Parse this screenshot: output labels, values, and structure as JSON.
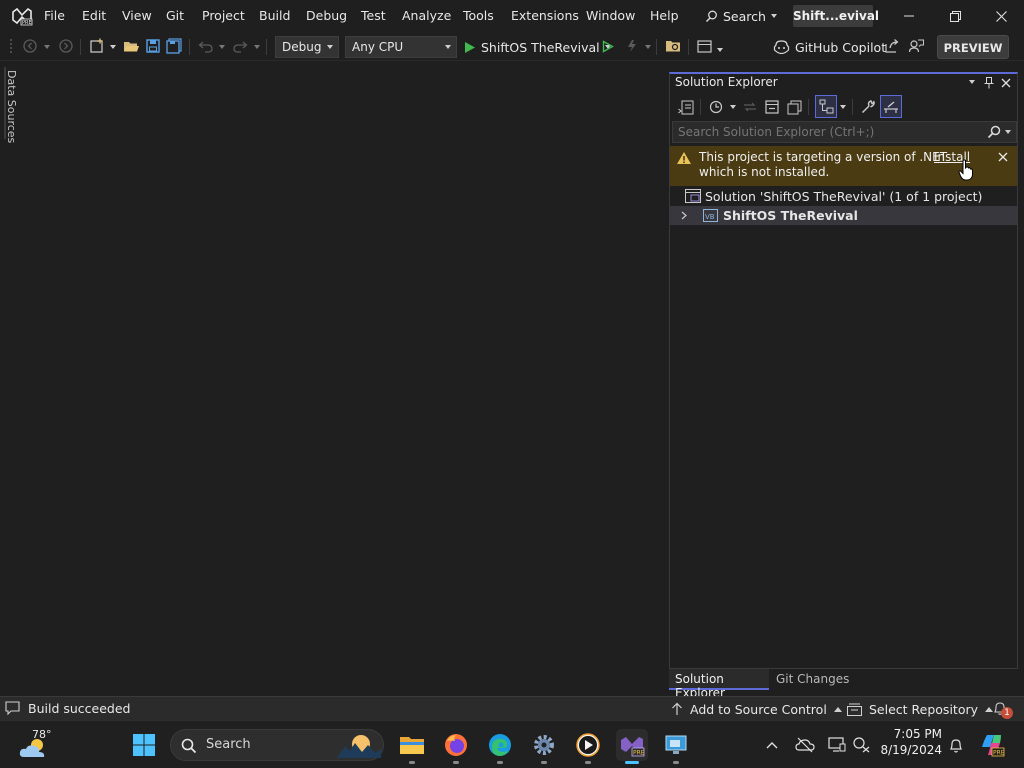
{
  "menu": {
    "items": [
      "File",
      "Edit",
      "View",
      "Git",
      "Project",
      "Build",
      "Debug",
      "Test",
      "Analyze",
      "Tools",
      "Extensions",
      "Window",
      "Help"
    ],
    "search_label": "Search",
    "solution_short": "Shift...evival"
  },
  "toolbar": {
    "config": "Debug",
    "platform": "Any CPU",
    "run_target": "ShiftOS TheRevival",
    "copilot": "GitHub Copilot",
    "preview": "PREVIEW"
  },
  "left_strip": {
    "label": "Data Sources"
  },
  "solution_explorer": {
    "title": "Solution Explorer",
    "search_placeholder": "Search Solution Explorer (Ctrl+;)",
    "warning": {
      "line1": "This project is targeting a version of .NET",
      "line2": "which is not installed.",
      "link": "Install"
    },
    "tree": {
      "solution": "Solution 'ShiftOS TheRevival' (1 of 1 project)",
      "project": "ShiftOS TheRevival"
    },
    "tabs": [
      "Solution Explorer",
      "Git Changes"
    ]
  },
  "status": {
    "build": "Build succeeded",
    "source_control": "Add to Source Control",
    "repository": "Select Repository",
    "notifications": "1"
  },
  "taskbar": {
    "weather_temp": "78°",
    "search_label": "Search",
    "time": "7:05 PM",
    "date": "8/19/2024"
  },
  "colors": {
    "accent": "#5d6bd8",
    "warning_bg": "#4a3b13",
    "run_green": "#3fb950",
    "taskbar_active": "#4cc2ff"
  }
}
